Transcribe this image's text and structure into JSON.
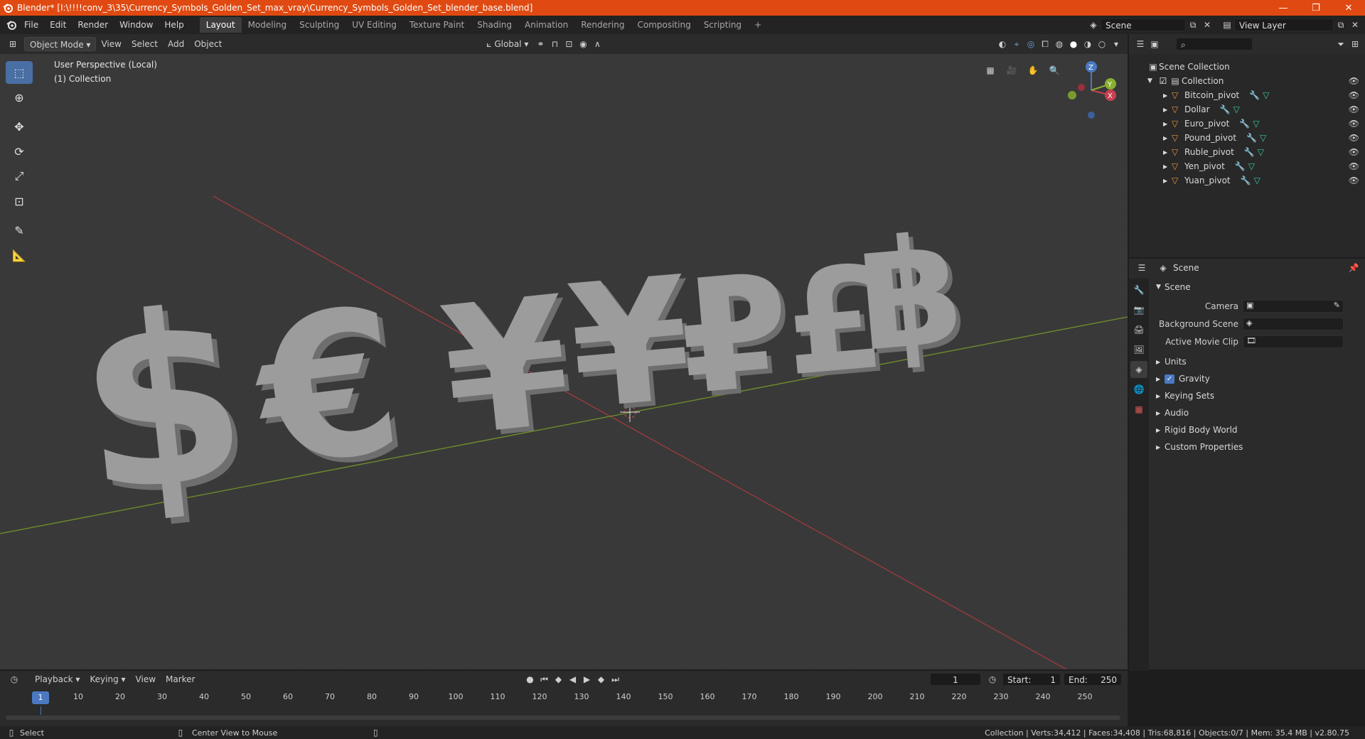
{
  "window": {
    "title": "Blender* [I:\\!!!!conv_3\\35\\Currency_Symbols_Golden_Set_max_vray\\Currency_Symbols_Golden_Set_blender_base.blend]",
    "minimize": "—",
    "restore": "❐",
    "close": "✕"
  },
  "menu": {
    "items": [
      "File",
      "Edit",
      "Render",
      "Window",
      "Help"
    ],
    "workspaces": [
      "Layout",
      "Modeling",
      "Sculpting",
      "UV Editing",
      "Texture Paint",
      "Shading",
      "Animation",
      "Rendering",
      "Compositing",
      "Scripting"
    ],
    "active_workspace": "Layout",
    "add_workspace": "+",
    "scene_name": "Scene",
    "view_layer": "View Layer"
  },
  "viewport_header": {
    "mode": "Object Mode",
    "menus": [
      "View",
      "Select",
      "Add",
      "Object"
    ],
    "transform_orientation": "Global"
  },
  "viewport": {
    "perspective_label": "User Perspective (Local)",
    "collection_label": "(1) Collection",
    "symbols": [
      "$",
      "€",
      "¥",
      "¥",
      "₽",
      "£",
      "฿"
    ],
    "gizmo": {
      "x": "X",
      "y": "Y",
      "z": "Z"
    },
    "colors": {
      "background": "#393939",
      "x_axis": "#b3363f",
      "y_axis": "#6d8c2c",
      "mesh": "#9a9a9a",
      "accent": "#4a79c2"
    }
  },
  "outliner": {
    "search_placeholder": "",
    "scene_collection": "Scene Collection",
    "collection": "Collection",
    "objects": [
      "Bitcoin_pivot",
      "Dollar",
      "Euro_pivot",
      "Pound_pivot",
      "Ruble_pivot",
      "Yen_pivot",
      "Yuan_pivot"
    ]
  },
  "properties": {
    "context": "Scene",
    "panel_title": "Scene",
    "fields": [
      {
        "label": "Camera",
        "value": ""
      },
      {
        "label": "Background Scene",
        "value": ""
      },
      {
        "label": "Active Movie Clip",
        "value": ""
      }
    ],
    "sections": [
      "Units",
      "Gravity",
      "Keying Sets",
      "Audio",
      "Rigid Body World",
      "Custom Properties"
    ],
    "gravity_checked": true
  },
  "timeline": {
    "menus": [
      "Playback",
      "Keying",
      "View",
      "Marker"
    ],
    "current_frame": "1",
    "start_label": "Start:",
    "start": "1",
    "end_label": "End:",
    "end": "250",
    "ticks": [
      "10",
      "20",
      "30",
      "40",
      "50",
      "60",
      "70",
      "80",
      "90",
      "100",
      "110",
      "120",
      "130",
      "140",
      "150",
      "160",
      "170",
      "180",
      "190",
      "200",
      "210",
      "220",
      "230",
      "240",
      "250"
    ]
  },
  "status": {
    "left_action": "Select",
    "middle_action": "Center View to Mouse",
    "stats": "Collection | Verts:34,412 | Faces:34,408 | Tris:68,816 | Objects:0/7 | Mem: 35.4 MB | v2.80.75"
  }
}
